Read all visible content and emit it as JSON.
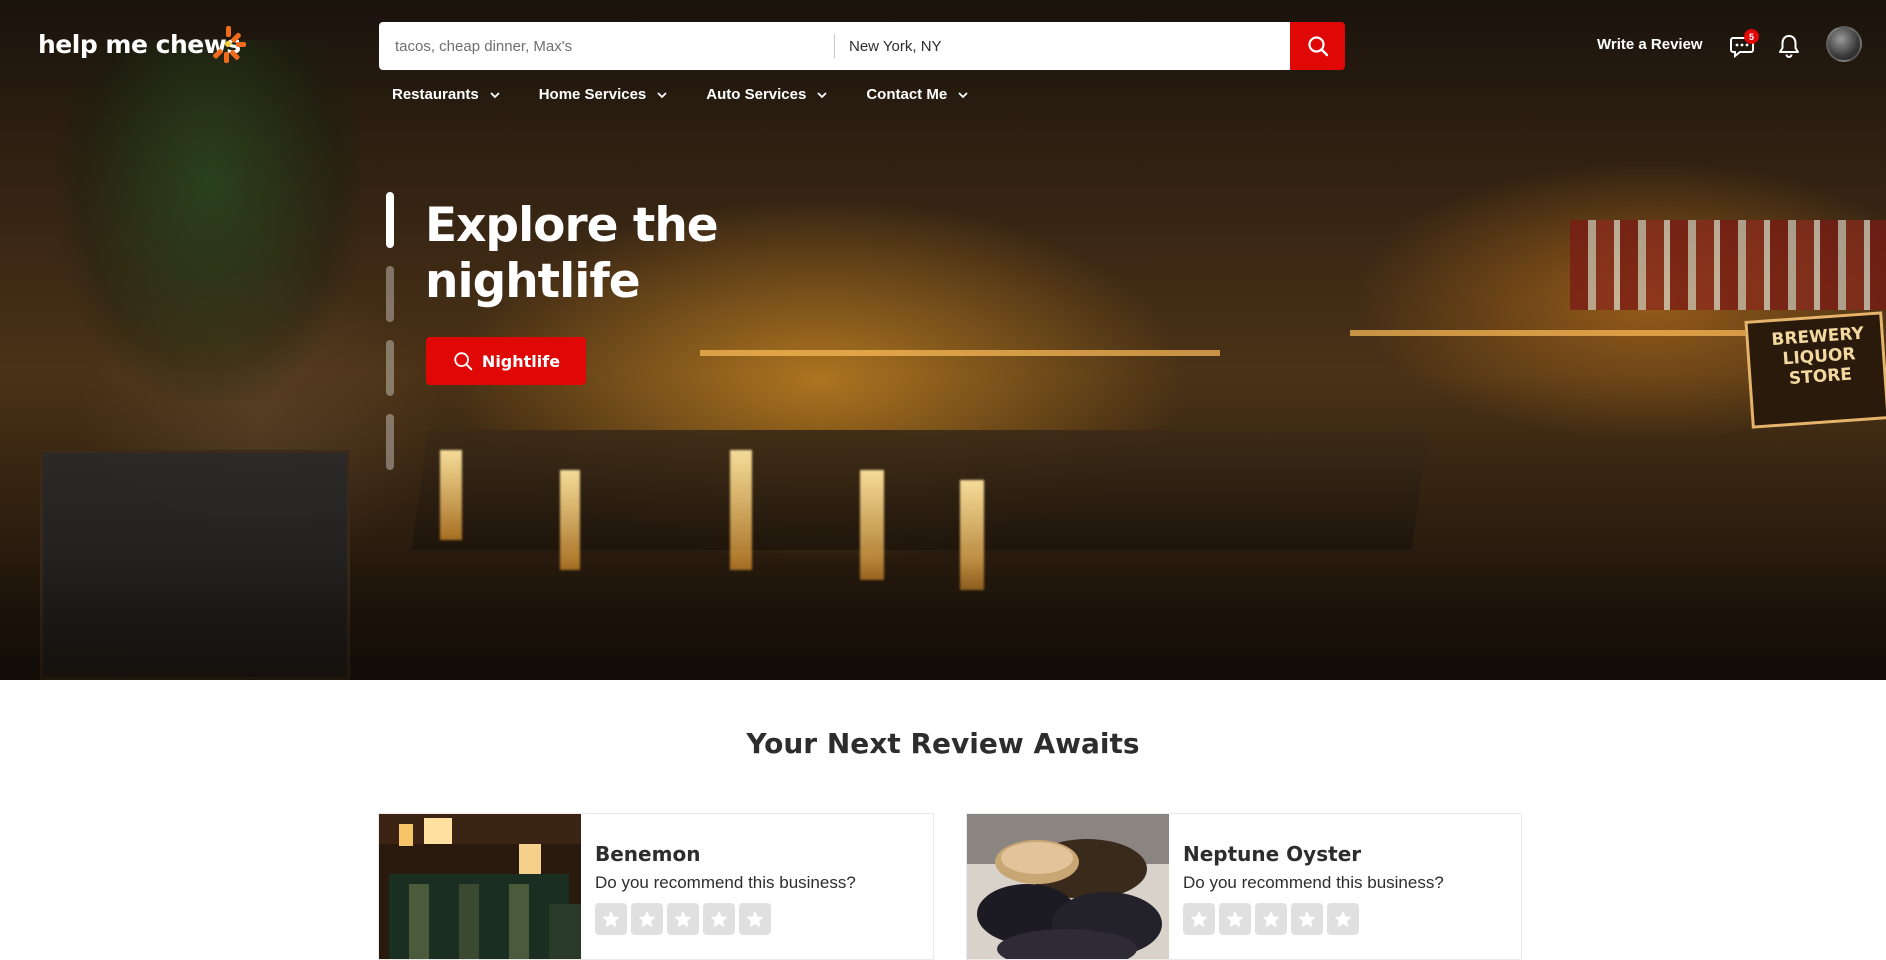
{
  "brand": {
    "logo_text": "help me chews",
    "accent_color": "#e00707"
  },
  "search": {
    "find_placeholder": "tacos, cheap dinner, Max's",
    "location_value": "New York, NY",
    "button_icon": "search-icon"
  },
  "nav": {
    "items": [
      {
        "label": "Restaurants",
        "icon": "chevron-down-icon"
      },
      {
        "label": "Home Services",
        "icon": "chevron-down-icon"
      },
      {
        "label": "Auto Services",
        "icon": "chevron-down-icon"
      },
      {
        "label": "Contact Me",
        "icon": "chevron-down-icon"
      }
    ]
  },
  "header_actions": {
    "write_review_label": "Write a Review",
    "messages_badge": "5",
    "messages_icon": "chat-icon",
    "notifications_icon": "bell-icon",
    "avatar_icon": "user-avatar"
  },
  "hero": {
    "title": "Explore the nightlife",
    "button_label": "Nightlife",
    "button_icon": "search-icon",
    "slides_count": 4,
    "active_slide": 1,
    "sign_text": "BREWERY LIQUOR STORE"
  },
  "review_section": {
    "title": "Your Next Review Awaits",
    "cards": [
      {
        "name": "Benemon",
        "question": "Do you recommend this business?",
        "rating_icon": "star-icon"
      },
      {
        "name": "Neptune Oyster",
        "question": "Do you recommend this business?",
        "rating_icon": "star-icon"
      }
    ]
  }
}
